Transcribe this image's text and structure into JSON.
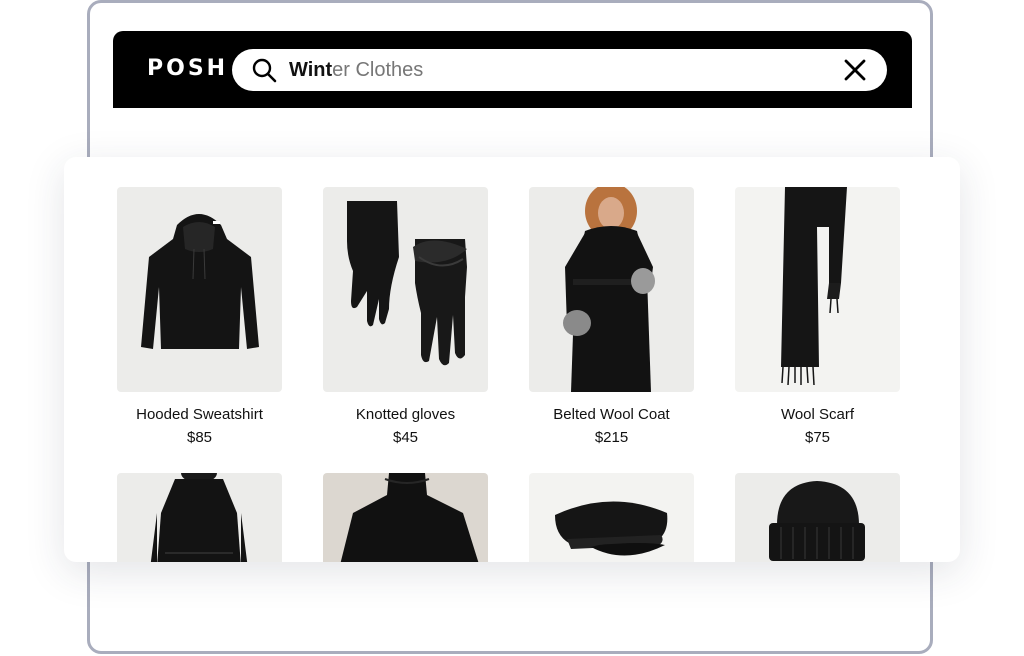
{
  "app": {
    "logo": "POSH"
  },
  "search": {
    "typed": "Wint",
    "suggestion": "er Clothes"
  },
  "products": [
    {
      "name": "Hooded Sweatshirt",
      "price": "$85",
      "icon": "hoodie"
    },
    {
      "name": "Knotted gloves",
      "price": "$45",
      "icon": "gloves"
    },
    {
      "name": "Belted Wool Coat",
      "price": "$215",
      "icon": "coat"
    },
    {
      "name": "Wool Scarf",
      "price": "$75",
      "icon": "scarf"
    }
  ],
  "more_products": [
    {
      "icon": "jacket-back"
    },
    {
      "icon": "turtleneck"
    },
    {
      "icon": "cap"
    },
    {
      "icon": "beanie"
    }
  ],
  "colors": {
    "header": "#000000",
    "frame": "#a9adbd",
    "text": "#111111"
  }
}
